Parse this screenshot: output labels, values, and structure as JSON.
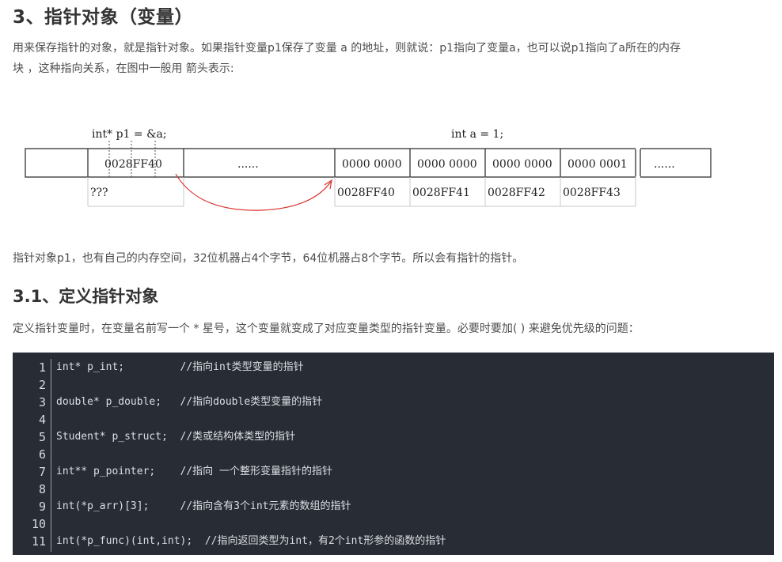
{
  "heading_main": "3、指针对象（变量）",
  "para1": {
    "line1": "用来保存指针的对象，就是指针对象。如果指针变量p1保存了变量 a 的地址，则就说：p1指向了变量a，也可以说p1指向了a所在的内存",
    "line2": "块 ，这种指向关系，在图中一般用 箭头表示:"
  },
  "figure": {
    "label_left": "int* p1 = &a;",
    "label_right": "int a = 1;",
    "ptr_value": "0028FF40",
    "ptr_addr": "???",
    "dots": "......",
    "cells": [
      "0000 0000",
      "0000 0000",
      "0000 0000",
      "0000 0001"
    ],
    "addresses": [
      "0028FF40",
      "0028FF41",
      "0028FF42",
      "0028FF43"
    ],
    "dots_right": "......",
    "arrow_color": "#d9302c"
  },
  "para2": "指针对象p1，也有自己的内存空间，32位机器占4个字节，64位机器占8个字节。所以会有指针的指针。",
  "heading_sub": "3.1、定义指针对象",
  "para3": "定义指针变量时，在变量名前写一个 * 星号，这个变量就变成了对应变量类型的指针变量。必要时要加( ) 来避免优先级的问题：",
  "code": {
    "background": "#282c34",
    "line_numbers": [
      "1",
      "2",
      "3",
      "4",
      "5",
      "6",
      "7",
      "8",
      "9",
      "10",
      "11"
    ],
    "lines": [
      "int* p_int;         //指向int类型变量的指针",
      "",
      "double* p_double;   //指向double类型变量的指针",
      "",
      "Student* p_struct;  //类或结构体类型的指针",
      "",
      "int** p_pointer;    //指向 一个整形变量指针的指针",
      "",
      "int(*p_arr)[3];     //指向含有3个int元素的数组的指针",
      "",
      "int(*p_func)(int,int);  //指向返回类型为int，有2个int形参的函数的指针"
    ]
  }
}
